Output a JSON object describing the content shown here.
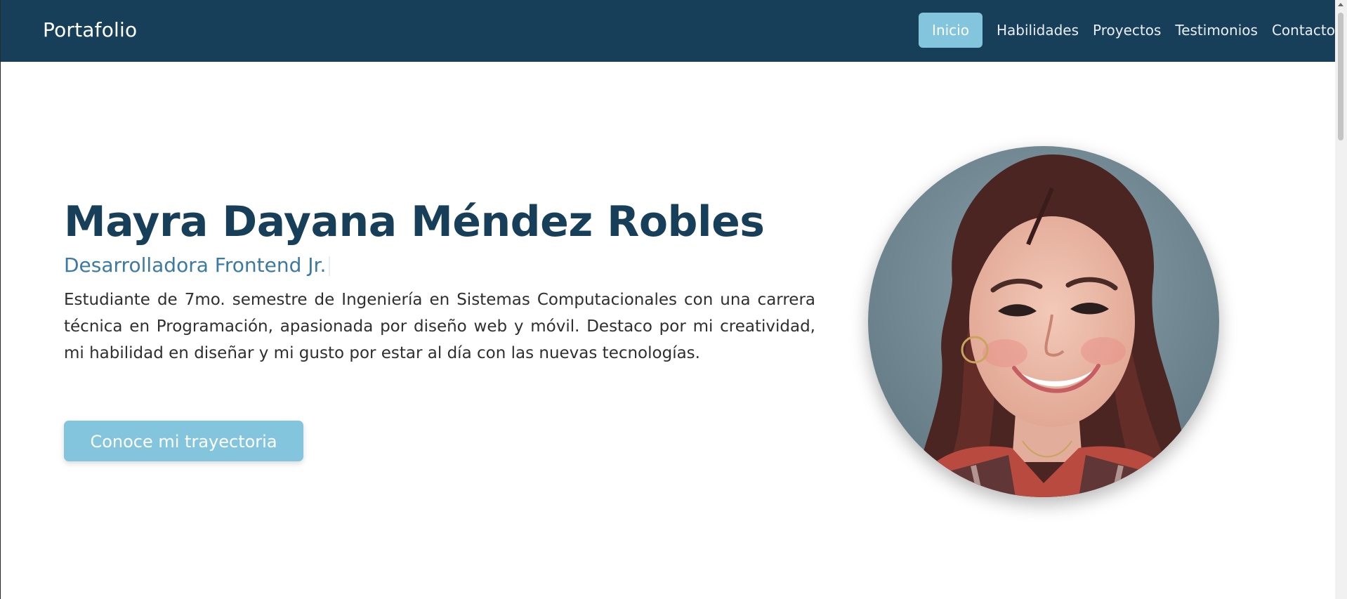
{
  "navbar": {
    "brand": "Portafolio",
    "links": [
      {
        "label": "Inicio",
        "active": true
      },
      {
        "label": "Habilidades",
        "active": false
      },
      {
        "label": "Proyectos",
        "active": false
      },
      {
        "label": "Testimonios",
        "active": false
      },
      {
        "label": "Contacto",
        "active": false
      }
    ]
  },
  "hero": {
    "name": "Mayra Dayana Méndez Robles",
    "role": "Desarrolladora Frontend Jr.",
    "bio": "Estudiante de 7mo. semestre de Ingeniería en Sistemas Computacionales con una carrera técnica en Programación, apasionada por diseño web y móvil. Destaco por mi creatividad, mi habilidad en diseñar y mi gusto por estar al día con las nuevas tecnologías.",
    "cta_label": "Conoce mi trayectoria"
  },
  "colors": {
    "navbar_bg": "#173f5a",
    "accent": "#83c5dc",
    "name_color": "#173f5a",
    "role_color": "#3b7aa3"
  }
}
